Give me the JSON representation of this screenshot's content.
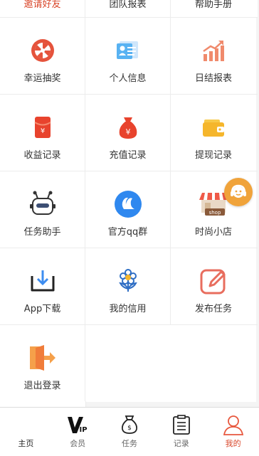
{
  "top_cut_labels": [
    "邀请好友",
    "团队报表",
    "帮助手册"
  ],
  "grid": [
    [
      "幸运抽奖",
      "个人信息",
      "日结报表"
    ],
    [
      "收益记录",
      "充值记录",
      "提现记录"
    ],
    [
      "任务助手",
      "官方qq群",
      "时尚小店"
    ],
    [
      "App下载",
      "我的信用",
      "发布任务"
    ],
    [
      "退出登录",
      "",
      ""
    ]
  ],
  "icons": [
    [
      "wheel-icon",
      "id-card-icon",
      "chart-up-icon"
    ],
    [
      "red-envelope-icon",
      "money-bag-icon",
      "wallet-icon"
    ],
    [
      "robot-icon",
      "qq-icon",
      "shop-icon"
    ],
    [
      "download-icon",
      "flower-icon",
      "edit-icon"
    ],
    [
      "logout-icon",
      "",
      ""
    ]
  ],
  "shop_badge": "shop",
  "tabbar": [
    {
      "label": "主页",
      "icon": "home-icon"
    },
    {
      "label": "会员",
      "icon": "vip-icon"
    },
    {
      "label": "任务",
      "icon": "money-bag-outline-icon"
    },
    {
      "label": "记录",
      "icon": "clipboard-icon"
    },
    {
      "label": "我的",
      "icon": "person-icon"
    }
  ],
  "vip_glyph": "VIP",
  "colors": {
    "accent": "#d9472b",
    "orange": "#f0a33a",
    "blue": "#3d8df0"
  }
}
